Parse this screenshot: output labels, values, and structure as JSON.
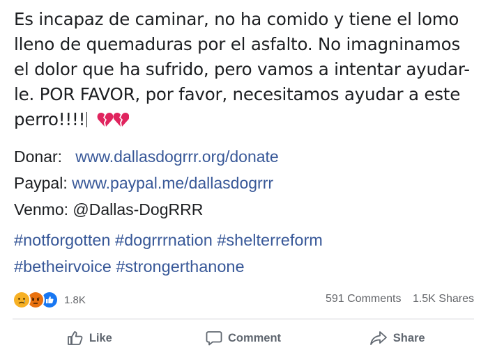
{
  "post": {
    "lines": [
      "Es incapaz de caminar, no ha comido y tiene el lomo",
      "lleno de quemaduras por el asfalto. No imagninamos",
      "el dolor que ha sufrido, pero vamos a intentar ayudar-",
      "le. POR FAVOR, por favor, necesitamos ayudar a este",
      "perro!!!!"
    ],
    "emoji": "broken-heart-icon x2"
  },
  "donations": {
    "donar_label": "Donar:",
    "donar_link": "www.dallasdogrrr.org/donate",
    "paypal_label": "Paypal:",
    "paypal_link": "www.paypal.me/dallasdogrrr",
    "venmo_label": "Venmo:",
    "venmo_handle": "@Dallas-DogRRR"
  },
  "hashtags": {
    "line1": "#notforgotten #dogrrrnation #shelterreform",
    "line2": "#betheirvoice #strongerthanone"
  },
  "stats": {
    "reactions": [
      "sad-reaction-icon",
      "angry-reaction-icon",
      "like-reaction-icon"
    ],
    "reaction_count": "1.8K",
    "comments": "591 Comments",
    "shares": "1.5K Shares"
  },
  "actions": {
    "like": "Like",
    "comment": "Comment",
    "share": "Share"
  },
  "colors": {
    "link": "#385898",
    "text": "#1c1e21",
    "muted": "#65676b",
    "heart": "#e0245e"
  }
}
